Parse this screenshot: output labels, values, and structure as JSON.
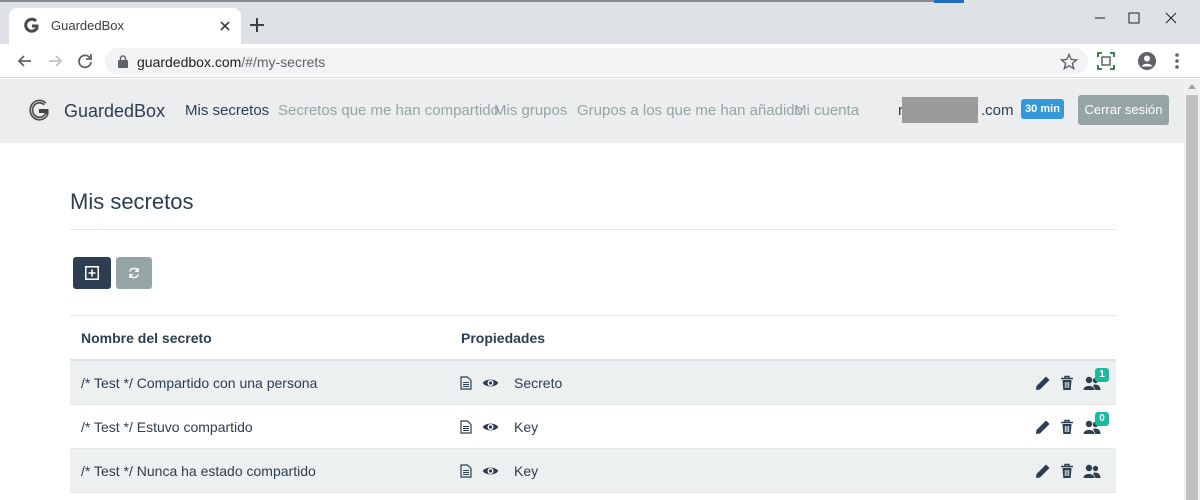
{
  "browser": {
    "tab_title": "GuardedBox",
    "url_host": "guardedbox.com",
    "url_path": "/#/my-secrets"
  },
  "app": {
    "brand": "GuardedBox",
    "nav": [
      {
        "label": "Mis secretos",
        "active": true
      },
      {
        "label": "Secretos que me han compartido",
        "active": false
      },
      {
        "label": "Mis grupos",
        "active": false
      },
      {
        "label": "Grupos a los que me han añadido",
        "active": false
      },
      {
        "label": "Mi cuenta",
        "active": false
      }
    ],
    "user_email_prefix": "r",
    "user_email_suffix": ".com",
    "session_timer": "30 min",
    "logout_label": "Cerrar sesión"
  },
  "page": {
    "title": "Mis secretos"
  },
  "table": {
    "headers": [
      "Nombre del secreto",
      "Propiedades"
    ],
    "rows": [
      {
        "name": "/* Test */ Compartido con una persona",
        "type": "Secreto",
        "share_count": "1"
      },
      {
        "name": "/* Test */ Estuvo compartido",
        "type": "Key",
        "share_count": "0"
      },
      {
        "name": "/* Test */ Nunca ha estado compartido",
        "type": "Key",
        "share_count": null
      }
    ]
  },
  "colors": {
    "primary": "#2c3e50",
    "muted": "#95a5a6",
    "info": "#3498db",
    "success": "#18bc9c",
    "stripe": "#ecf0f1"
  },
  "icons": {
    "add": "plus-square-icon",
    "refresh": "refresh-icon",
    "document": "document-icon",
    "view": "eye-icon",
    "edit": "pencil-icon",
    "delete": "trash-icon",
    "share": "users-icon"
  }
}
